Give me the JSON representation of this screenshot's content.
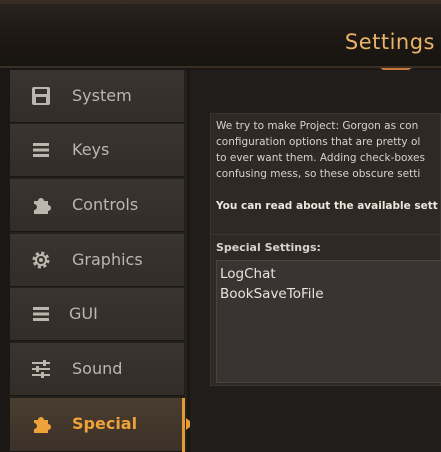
{
  "window": {
    "title": "Settings"
  },
  "sidebar": {
    "items": [
      {
        "label": "System",
        "icon": "floppy-disk-icon"
      },
      {
        "label": "Keys",
        "icon": "list-lines-icon"
      },
      {
        "label": "Controls",
        "icon": "puzzle-piece-icon"
      },
      {
        "label": "Graphics",
        "icon": "gear-icon"
      },
      {
        "label": "GUI",
        "icon": "list-lines-icon"
      },
      {
        "label": "Sound",
        "icon": "sliders-icon"
      },
      {
        "label": "Special",
        "icon": "puzzle-piece-icon",
        "active": true
      }
    ]
  },
  "main": {
    "description_lines": [
      "We try to make Project: Gorgon as con",
      "configuration options that are pretty ol",
      "to ever want them. Adding check-boxes",
      "confusing mess, so these obscure setti"
    ],
    "read_more": "You can read about the available sett",
    "special_settings": {
      "header": "Special Settings:",
      "items": [
        "LogChat",
        "BookSaveToFile"
      ]
    }
  },
  "colors": {
    "accent": "#f0a23a",
    "title": "#e9b46a",
    "panel": "#2e2925"
  }
}
